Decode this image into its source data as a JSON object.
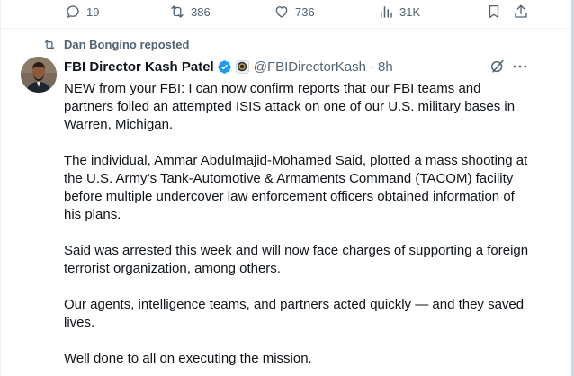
{
  "actions": {
    "reply": {
      "icon": "reply-icon",
      "count": "19"
    },
    "repost": {
      "icon": "repost-icon",
      "count": "386"
    },
    "like": {
      "icon": "heart-icon",
      "count": "736"
    },
    "views": {
      "icon": "views-icon",
      "count": "31K"
    },
    "bookmark": {
      "icon": "bookmark-icon"
    },
    "share": {
      "icon": "share-icon"
    }
  },
  "repost_context": {
    "icon": "repost-icon",
    "text": "Dan Bongino reposted"
  },
  "tweet": {
    "author": {
      "display_name": "FBI Director Kash Patel",
      "handle": "@FBIDirectorKash",
      "verified": true,
      "affiliation_icon": "fbi-seal-icon"
    },
    "separator": "·",
    "time": "8h",
    "paragraphs": [
      "NEW from your FBI: I can now confirm reports that our FBI teams and partners foiled an attempted ISIS attack on one of our U.S. military bases in Warren, Michigan.",
      "The individual, Ammar Abdulmajid-Mohamed Said, plotted a mass shooting at the U.S. Army’s Tank-Automotive & Armaments Command (TACOM) facility before multiple undercover law enforcement officers obtained information of his plans.",
      "Said was arrested this week and will now face charges of supporting a foreign terrorist organization, among others.",
      "Our agents, intelligence teams, and partners acted quickly — and they saved lives.",
      "Well done to all on executing the mission."
    ]
  },
  "colors": {
    "text": "#0f1419",
    "secondary": "#536471",
    "verified_blue": "#1d9bf0",
    "divider": "#eff3f4"
  }
}
